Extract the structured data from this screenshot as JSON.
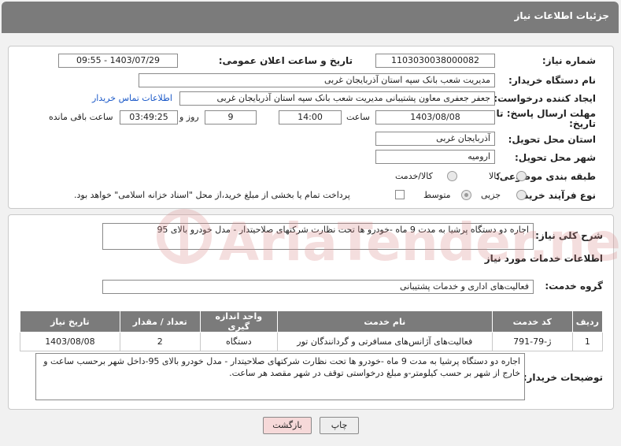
{
  "header": {
    "title": "جزئیات اطلاعات نیاز"
  },
  "form": {
    "need_number_label": "شماره نیاز:",
    "need_number": "1103030038000082",
    "announce_label": "تاریخ و ساعت اعلان عمومی:",
    "announce_value": "1403/07/29 - 09:55",
    "buyer_org_label": "نام دستگاه خریدار:",
    "buyer_org": "مدیریت شعب بانک سپه استان آذربایجان غربی",
    "requester_label": "ایجاد کننده درخواست:",
    "requester": "جعفر جعفری معاون پشتیبانی مدیریت شعب بانک سپه استان آذربایجان غربی",
    "buyer_contact_link": "اطلاعات تماس خریدار",
    "deadline_label_1": "مهلت ارسال پاسخ: تا",
    "deadline_label_2": "تاریخ:",
    "deadline_date": "1403/08/08",
    "time_label": "ساعت",
    "deadline_time": "14:00",
    "days_value": "9",
    "days_label": "روز و",
    "remaining_time": "03:49:25",
    "remaining_label": "ساعت باقی مانده",
    "province_label": "استان محل تحویل:",
    "province": "آذربایجان غربی",
    "city_label": "شهر محل تحویل:",
    "city": "ارومیه",
    "category_label": "طبقه بندی موضوعی:",
    "category_options": [
      "کالا",
      "کالا/خدمت"
    ],
    "purchase_type_label": "نوع فرآیند خرید :",
    "purchase_type_options": [
      "جزیی",
      "متوسط"
    ],
    "treasury_note": "پرداخت تمام یا بخشی از مبلغ خرید،از محل \"اسناد خزانه اسلامی\" خواهد بود."
  },
  "description": {
    "label": "شرح کلی نیاز:",
    "text": "اجاره دو دستگاه پرشیا به مدت 9 ماه -خودرو ها تحت نظارت شرکتهای صلاحیتدار - مدل خودرو بالای 95"
  },
  "services": {
    "section_title": "اطلاعات خدمات مورد نیاز",
    "group_label": "گروه خدمت:",
    "group_value": "فعالیت‌های اداری و خدمات پشتیبانی",
    "columns": [
      "ردیف",
      "کد خدمت",
      "نام خدمت",
      "واحد اندازه گیری",
      "تعداد / مقدار",
      "تاریخ نیاز"
    ],
    "rows": [
      {
        "row": "1",
        "code": "ژ-79-791",
        "name": "فعالیت‌های آژانس‌های مسافرتی و گردانندگان تور",
        "unit": "دستگاه",
        "qty": "2",
        "date": "1403/08/08"
      }
    ]
  },
  "buyer_notes": {
    "label": "توضیحات خریدار:",
    "text": "اجاره دو دستگاه پرشیا به مدت 9 ماه -خودرو ها تحت نظارت شرکتهای صلاحیتدار - مدل خودرو بالای 95-داخل شهر برحسب ساعت و خارج از شهر بر حسب کیلومتر-و مبلغ درخواستی توقف در شهر مقصد هر ساعت."
  },
  "buttons": {
    "print": "چاپ",
    "back": "بازگشت"
  },
  "watermark": {
    "text": "AriaTender.net"
  },
  "colors": {
    "titlebar": "#7b7b7b",
    "link": "#1a58c8",
    "back_button": "#f6d9d9",
    "print_button": "#eeeeee",
    "watermark": "#d98a8a"
  }
}
